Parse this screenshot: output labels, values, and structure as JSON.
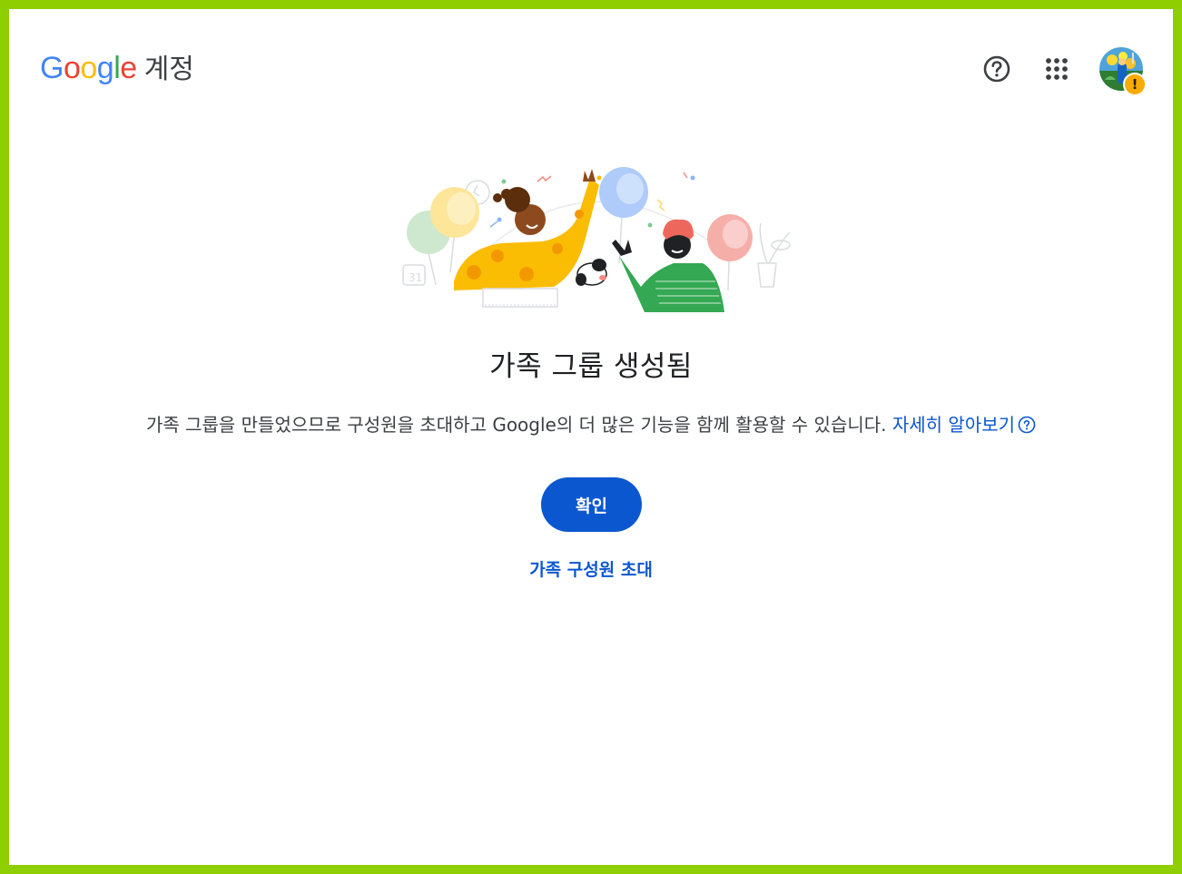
{
  "header": {
    "logo_text": "Google",
    "logo_suffix": "계정",
    "help_icon": "help-circle-icon",
    "apps_icon": "apps-grid-icon",
    "avatar_badge": "!"
  },
  "main": {
    "title": "가족 그룹 생성됨",
    "description": "가족 그룹을 만들었으므로 구성원을 초대하고 Google의 더 많은 기능을 함께 활용할 수 있습니다.",
    "learn_more": "자세히 알아보기",
    "confirm_button": "확인",
    "invite_link": "가족 구성원 초대"
  },
  "colors": {
    "frame": "#8fce00",
    "accent": "#0b57d0",
    "text_primary": "#202124",
    "text_secondary": "#3c4043",
    "google_blue": "#4285f4",
    "google_red": "#ea4335",
    "google_yellow": "#fbbc05",
    "google_green": "#34a853",
    "warning": "#f9ab00"
  }
}
